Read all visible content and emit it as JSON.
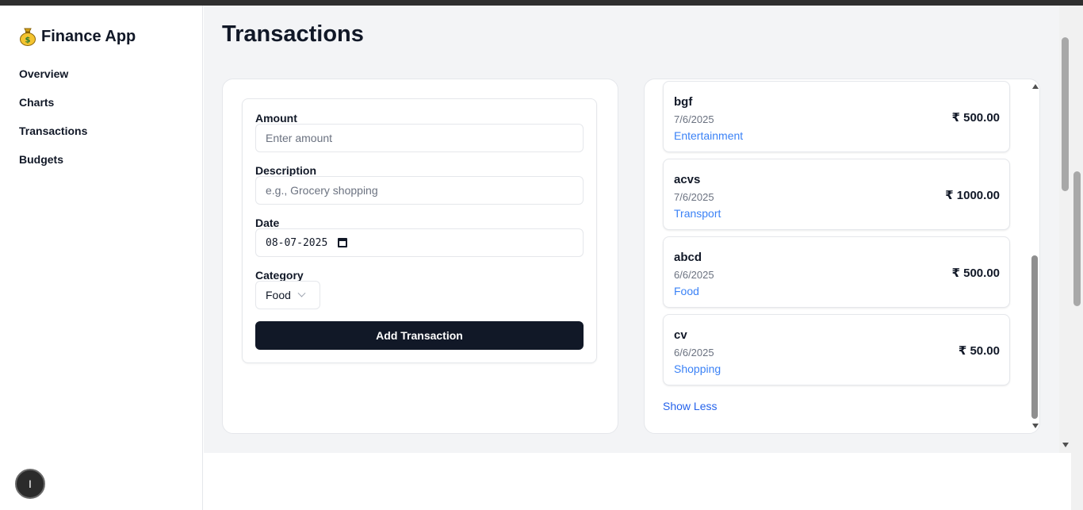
{
  "app": {
    "title": "Finance App",
    "logo_icon": "money-bag-icon"
  },
  "sidebar": {
    "items": [
      {
        "label": "Overview"
      },
      {
        "label": "Charts"
      },
      {
        "label": "Transactions"
      },
      {
        "label": "Budgets"
      }
    ]
  },
  "avatar": {
    "label": "I"
  },
  "page": {
    "title": "Transactions"
  },
  "form": {
    "amount_label": "Amount",
    "amount_placeholder": "Enter amount",
    "description_label": "Description",
    "description_placeholder": "e.g., Grocery shopping",
    "date_label": "Date",
    "date_value": "08-07-2025",
    "category_label": "Category",
    "category_value": "Food",
    "submit_label": "Add Transaction"
  },
  "transactions": [
    {
      "title": "bgf",
      "date": "7/6/2025",
      "category": "Entertainment",
      "amount": "₹ 500.00"
    },
    {
      "title": "acvs",
      "date": "7/6/2025",
      "category": "Transport",
      "amount": "₹ 1000.00"
    },
    {
      "title": "abcd",
      "date": "6/6/2025",
      "category": "Food",
      "amount": "₹ 500.00"
    },
    {
      "title": "cv",
      "date": "6/6/2025",
      "category": "Shopping",
      "amount": "₹ 50.00"
    }
  ],
  "list": {
    "toggle_label": "Show Less"
  },
  "colors": {
    "primary": "#111827",
    "link": "#2563eb",
    "category": "#3b82f6",
    "muted": "#6b7280",
    "page_bg": "#f3f4f6"
  }
}
